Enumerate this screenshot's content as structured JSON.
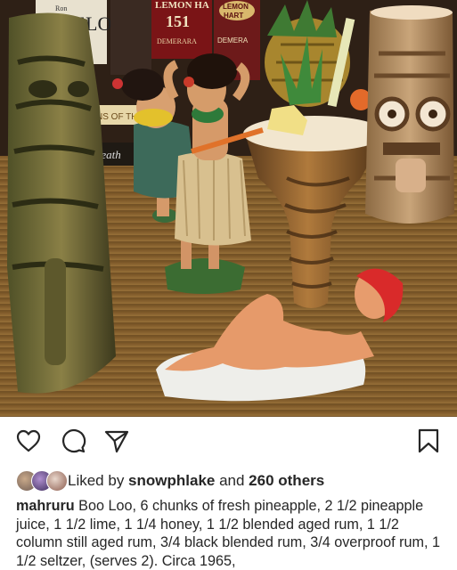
{
  "photo": {
    "label_bottle_left": "Ron",
    "label_bottle_left_2": "BUELO",
    "label_bottle_mid": "LEMON HA",
    "label_bottle_mid_2": "151",
    "label_bottle_mid_3": "DEMERARA",
    "label_bottle_right": "LEMON",
    "label_bottle_right_2": "HART",
    "label_bottle_right_3": "DEMERA",
    "label_book": "NS OF THE C",
    "label_book_2": "Death"
  },
  "actions": {
    "like_icon": "heart-outline-icon",
    "comment_icon": "speech-bubble-icon",
    "share_icon": "paper-plane-icon",
    "save_icon": "bookmark-icon"
  },
  "likes": {
    "prefix": "Liked by ",
    "user": "snowphlake",
    "middle": " and ",
    "others": "260 others"
  },
  "caption": {
    "username": "mahruru",
    "text": " Boo Loo, 6 chunks of fresh pineapple, 2 1/2 pineapple juice, 1 1/2 lime, 1 1/4 honey, 1 1/2 blended aged rum, 1 1/2 column still aged rum, 3/4 black blended rum, 3/4 overproof rum, 1 1/2 seltzer, (serves 2). Circa 1965,"
  }
}
